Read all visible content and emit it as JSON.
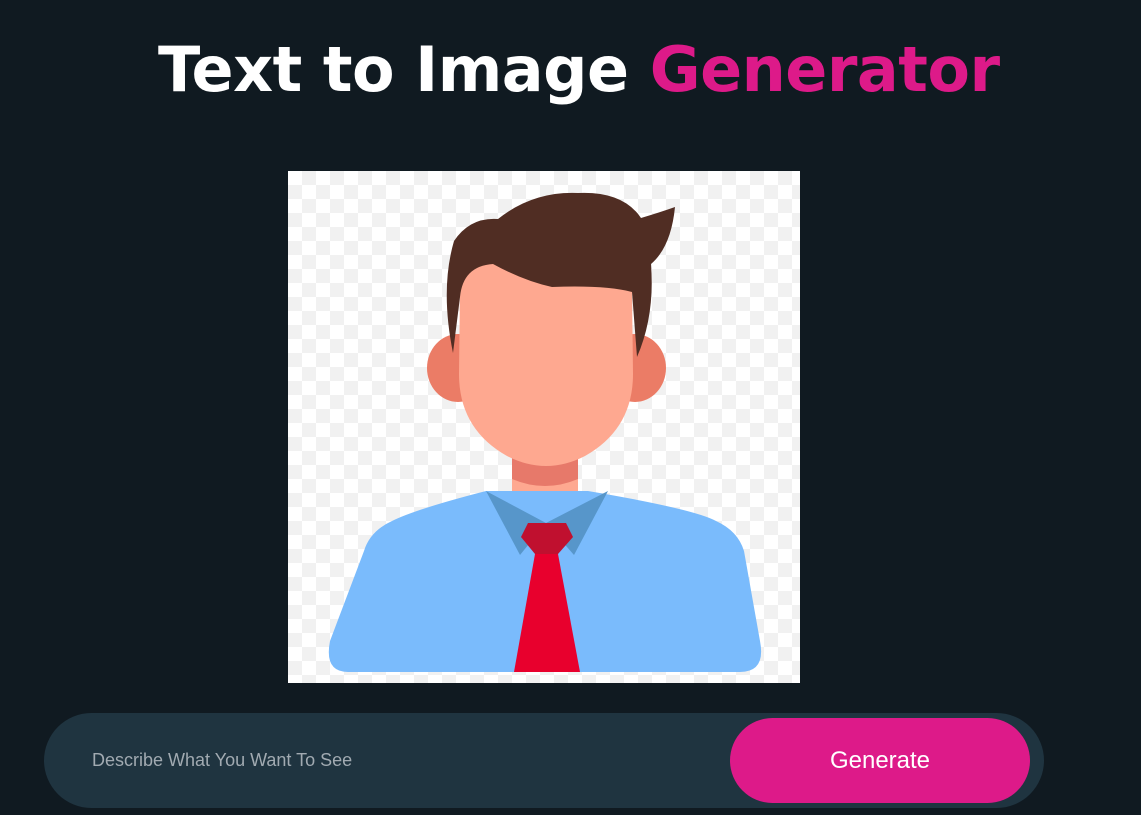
{
  "header": {
    "title_main": "Text to Image",
    "title_accent": "Generator",
    "accent_color": "#dd1a89"
  },
  "preview": {
    "icon": "businessman-avatar-icon",
    "background": "transparent-checkerboard"
  },
  "prompt": {
    "value": "",
    "placeholder": "Describe What You Want To See",
    "generate_label": "Generate"
  },
  "colors": {
    "page_background": "#101a21",
    "input_bar": "#1f3440",
    "button": "#dd1a89",
    "title_text": "#ffffff"
  }
}
